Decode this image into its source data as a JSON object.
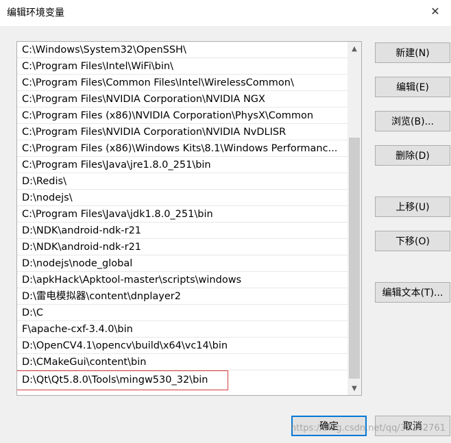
{
  "window": {
    "title": "编辑环境变量",
    "close_glyph": "✕"
  },
  "paths": [
    "C:\\Windows\\System32\\OpenSSH\\",
    "C:\\Program Files\\Intel\\WiFi\\bin\\",
    "C:\\Program Files\\Common Files\\Intel\\WirelessCommon\\",
    "C:\\Program Files\\NVIDIA Corporation\\NVIDIA NGX",
    "C:\\Program Files (x86)\\NVIDIA Corporation\\PhysX\\Common",
    "C:\\Program Files\\NVIDIA Corporation\\NVIDIA NvDLISR",
    "C:\\Program Files (x86)\\Windows Kits\\8.1\\Windows Performanc...",
    "C:\\Program Files\\Java\\jre1.8.0_251\\bin",
    "D:\\Redis\\",
    "D:\\nodejs\\",
    "C:\\Program Files\\Java\\jdk1.8.0_251\\bin",
    "D:\\NDK\\android-ndk-r21",
    "D:\\NDK\\android-ndk-r21",
    "D:\\nodejs\\node_global",
    "D:\\apkHack\\Apktool-master\\scripts\\windows",
    "D:\\雷电模拟器\\content\\dnplayer2",
    "D:\\C",
    "F\\apache-cxf-3.4.0\\bin",
    "D:\\OpenCV4.1\\opencv\\build\\x64\\vc14\\bin",
    "D:\\CMakeGui\\content\\bin",
    "D:\\Qt\\Qt5.8.0\\Tools\\mingw530_32\\bin"
  ],
  "buttons": {
    "new": "新建(N)",
    "edit": "编辑(E)",
    "browse": "浏览(B)...",
    "delete": "删除(D)",
    "move_up": "上移(U)",
    "move_down": "下移(O)",
    "edit_text": "编辑文本(T)...",
    "ok": "确定",
    "cancel": "取消"
  },
  "scroll": {
    "up_glyph": "▲",
    "down_glyph": "▼"
  },
  "watermark": "https://blog.csdn.net/qq/35142761",
  "colors": {
    "highlight_border": "#d23c3c",
    "primary_border": "#0078d7"
  }
}
